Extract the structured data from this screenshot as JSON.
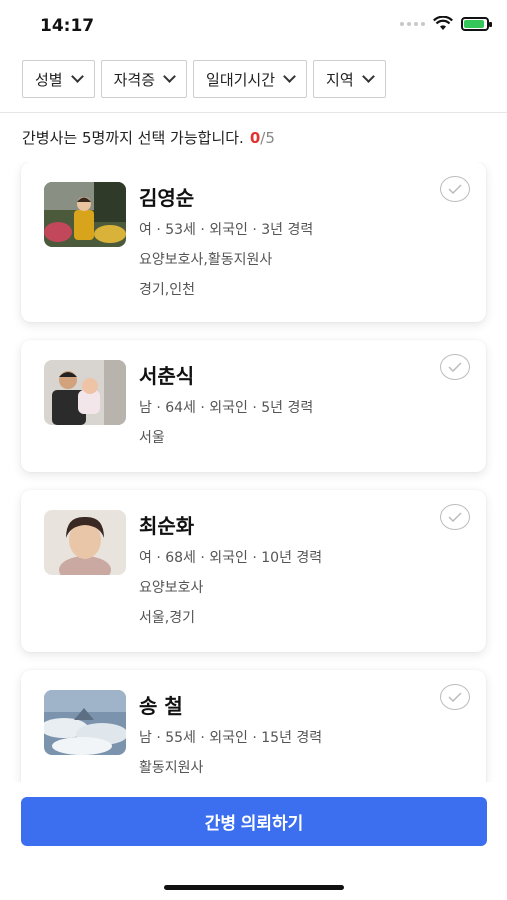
{
  "status_bar": {
    "time": "14:17",
    "battery_color": "#35c759"
  },
  "filters": [
    {
      "label": "성별"
    },
    {
      "label": "자격증"
    },
    {
      "label": "일대기시간"
    },
    {
      "label": "지역"
    }
  ],
  "selection": {
    "text": "간병사는 5명까지 선택 가능합니다.",
    "count": "0",
    "separator": "/",
    "max": "5",
    "count_color": "#e0342f"
  },
  "caregivers": [
    {
      "name": "김영순",
      "details": "여 · 53세 · 외국인 · 3년 경력",
      "certifications": "요양보호사,활동지원사",
      "regions": "경기,인천",
      "selected": false,
      "photo": "woman-garden-photo"
    },
    {
      "name": "서춘식",
      "details": "남 · 64세 · 외국인 · 5년 경력",
      "certifications": "",
      "regions": "서울",
      "selected": false,
      "photo": "man-with-baby-photo"
    },
    {
      "name": "최순화",
      "details": "여 · 68세 · 외국인 · 10년 경력",
      "certifications": "요양보호사",
      "regions": "서울,경기",
      "selected": false,
      "photo": "woman-portrait-photo"
    },
    {
      "name": "송 철",
      "details": "남 · 55세 · 외국인 · 15년 경력",
      "certifications": "활동지원사",
      "regions": "",
      "selected": false,
      "photo": "clouds-landscape-photo"
    }
  ],
  "actions": {
    "request_label": "간병 의뢰하기",
    "accent_color": "#3b6ff0"
  }
}
